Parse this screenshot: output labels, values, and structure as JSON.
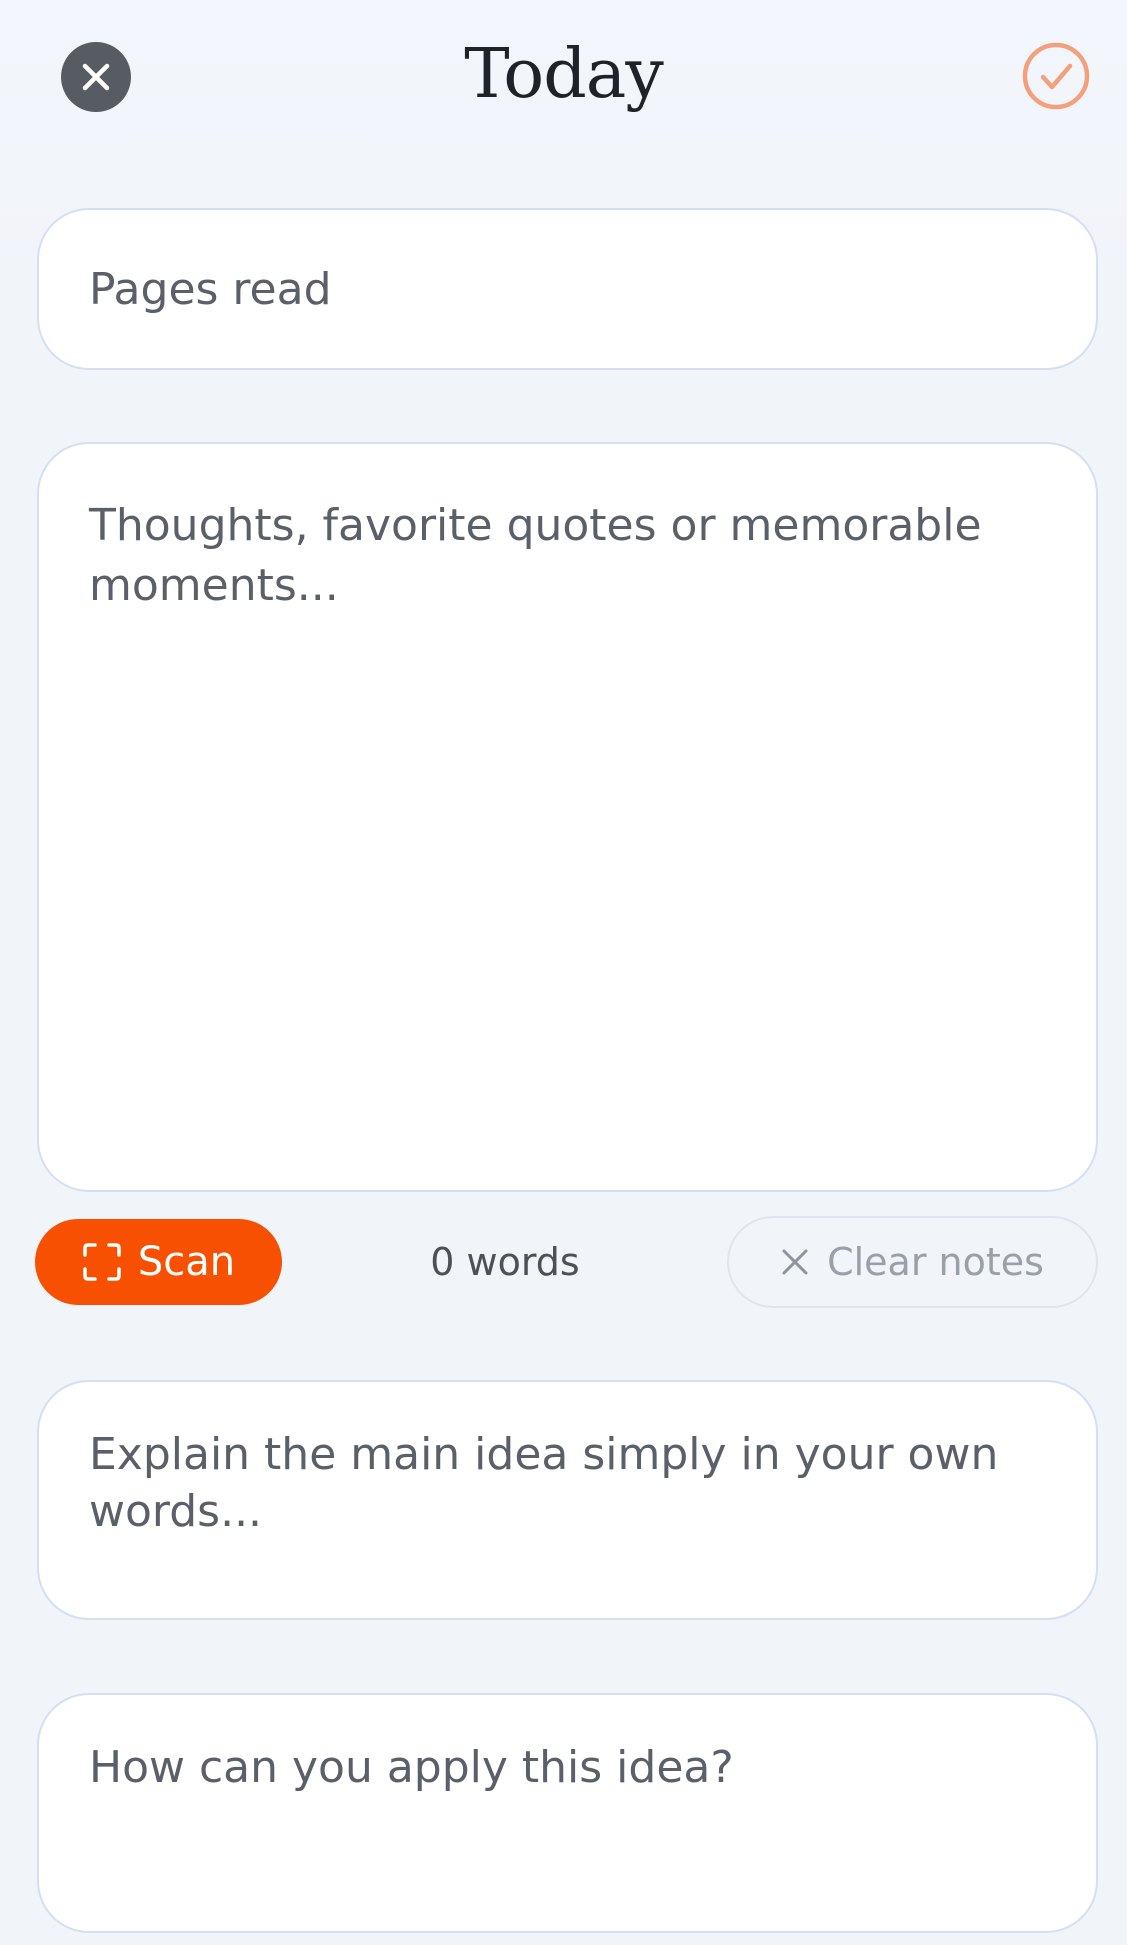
{
  "header": {
    "title": "Today",
    "close_icon": "close-icon",
    "done_icon": "checkmark-circle-icon",
    "accent_color": "#f4a07c"
  },
  "pages_field": {
    "placeholder": "Pages read",
    "value": ""
  },
  "notes_field": {
    "placeholder": "Thoughts, favorite quotes or memorable moments...",
    "value": ""
  },
  "toolbar": {
    "scan_label": "Scan",
    "scan_icon": "scan-frame-icon",
    "scan_color": "#f75000",
    "word_count": "0 words",
    "clear_label": "Clear notes",
    "clear_icon": "x-icon"
  },
  "explain_field": {
    "placeholder": "Explain the main idea simply in your own words...",
    "value": ""
  },
  "apply_field": {
    "placeholder": "How can you apply this idea?",
    "value": ""
  }
}
